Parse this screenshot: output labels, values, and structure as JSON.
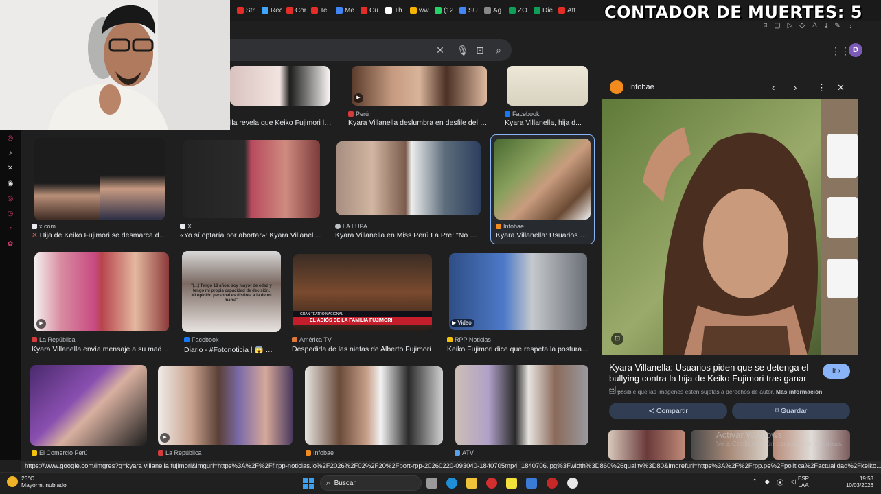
{
  "overlay": {
    "counter": "CONTADOR DE MUERTES: 5"
  },
  "browser": {
    "tabs": [
      {
        "label": "Str",
        "color": "#e52d27"
      },
      {
        "label": "Rec",
        "color": "#3ea6ff"
      },
      {
        "label": "Cor",
        "color": "#e52d27"
      },
      {
        "label": "Te",
        "color": "#e52d27"
      },
      {
        "label": "Me",
        "color": "#4285f4"
      },
      {
        "label": "Cu",
        "color": "#e52d27"
      },
      {
        "label": "Th",
        "color": "#ffffff"
      },
      {
        "label": "ww",
        "color": "#f4b400"
      },
      {
        "label": "(12",
        "color": "#25d366"
      },
      {
        "label": "SU",
        "color": "#4285f4"
      },
      {
        "label": "Ag",
        "color": "#888888"
      },
      {
        "label": "ZO",
        "color": "#0f9d58"
      },
      {
        "label": "Die",
        "color": "#0f9d58"
      },
      {
        "label": "Att",
        "color": "#e52d27"
      }
    ],
    "status_url": "https://www.google.com/imgres?q=kyara villanella fujimori&imgurl=https%3A%2F%2Ff.rpp-noticias.io%2F2026%2F02%2F20%2Fport-rpp-20260220-093040-1840705mp4_1840706.jpg%3Fwidth%3D860%26quality%3D80&imgrefurl=https%3A%2F%2Frpp.pe%2Fpolitica%2Factualidad%2Fkeiko..."
  },
  "account": {
    "initial": "D"
  },
  "social_icons": [
    "instagram-icon",
    "tiktok-icon",
    "x-icon",
    "discord-icon"
  ],
  "results": {
    "row0": [
      {
        "source": "",
        "caption": "lla revela que Keiko Fujimori le e..."
      },
      {
        "source": "Perú",
        "caption": "Kyara Villanella deslumbra en desfile del Miss ..."
      },
      {
        "source": "Facebook",
        "caption": "Kyara Villanella, hija d..."
      }
    ],
    "row1": [
      {
        "source": "x.com",
        "caption": "Hija de Keiko Fujimori se desmarca de ..."
      },
      {
        "source": "X",
        "caption": "«Yo sí optaría por abortar»: Kyara Villanell..."
      },
      {
        "source": "LA LUPA",
        "caption": "Kyara Villanella en Miss Perú La Pre: \"No quier..."
      },
      {
        "source": "Infobae",
        "caption": "Kyara Villanella: Usuarios pid..."
      }
    ],
    "row2": [
      {
        "source": "La República",
        "caption": "Kyara Villanella envía mensaje a su madre K..."
      },
      {
        "source": "Facebook",
        "caption": "Diario - #Fotonoticia | 😱 🔥 |..."
      },
      {
        "source": "América TV",
        "caption": "Despedida de las nietas de Alberto Fujimori"
      },
      {
        "source": "RPP Noticias",
        "caption": "Keiko Fujimori dice que respeta la postura de ..."
      }
    ],
    "row3": [
      {
        "source": "El Comercio Perú"
      },
      {
        "source": "La República"
      },
      {
        "source": "Infobae"
      },
      {
        "source": "ATV"
      }
    ],
    "thumb_texts": {
      "quote": "\"[...] Tengo 18 años, soy mayor de edad y tengo mi propia capacidad de decisión. Mi opinión personal es distinta a la de mi mamá\"",
      "banner_small": "GRAN TEATRO NACIONAL",
      "banner": "EL ADIÓS DE LA FAMILIA FUJIMORI",
      "video_label": "Video"
    }
  },
  "panel": {
    "source": "Infobae",
    "title": "Kyara Villanella: Usuarios piden que se detenga el bullying contra la hija de Keiko Fujimori tras ganar el...",
    "go_label": "Ir",
    "note": "Es posible que las imágenes estén sujetas a derechos de autor.",
    "note_link": "Más información",
    "share_label": "Compartir",
    "save_label": "Guardar"
  },
  "watermark": {
    "line1": "Activar Windows",
    "line2": "Ve a Configuración para activar Windows."
  },
  "taskbar": {
    "temp": "23°C",
    "weather": "Mayorm. nublado",
    "search_label": "Buscar",
    "lang1": "ESP",
    "lang2": "LAA",
    "time": "19:53",
    "date": "10/03/2026"
  }
}
